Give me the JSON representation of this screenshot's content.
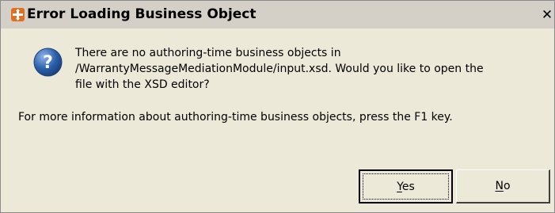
{
  "dialog": {
    "title": "Error Loading Business Object",
    "close_symbol": "✕",
    "icons": {
      "title_icon": "business-object-error-icon",
      "message_icon": "question-icon"
    },
    "message_lines": [
      "There are no authoring-time business objects in",
      "/WarrantyMessageMediationModule/input.xsd.  Would you like to open the",
      "file with the XSD editor?"
    ],
    "info_text": "For more information about authoring-time business objects, press the F1 key.",
    "buttons": {
      "yes": {
        "mnemonic": "Y",
        "rest": "es"
      },
      "no": {
        "mnemonic": "N",
        "rest": "o"
      }
    },
    "colors": {
      "title_icon_bg": "#e07020",
      "question_icon_bg": "#2a5fa8"
    }
  }
}
